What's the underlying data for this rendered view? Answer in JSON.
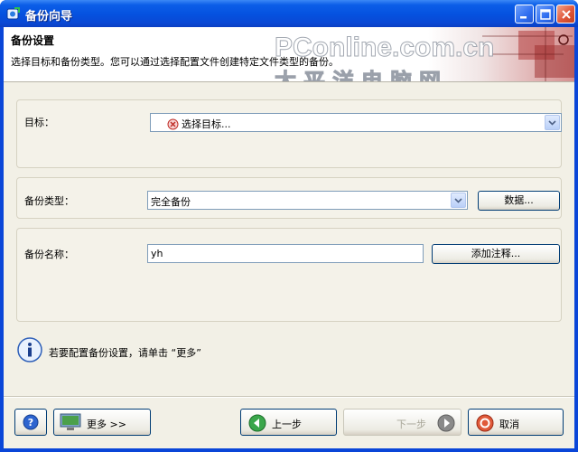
{
  "window": {
    "title": "备份向导"
  },
  "header": {
    "title": "备份设置",
    "description": "选择目标和备份类型。您可以通过选择配置文件创建特定文件类型的备份。",
    "watermark_brand": "PConline.com.cn",
    "watermark_cn": "太平洋电脑网"
  },
  "target": {
    "label": "目标：",
    "value": "选择目标..."
  },
  "backup_type": {
    "label": "备份类型：",
    "value": "完全备份",
    "button": "数据..."
  },
  "backup_name": {
    "label": "备份名称：",
    "value": "yh",
    "button": "添加注释..."
  },
  "info": {
    "text": "若要配置备份设置，请单击 “更多”"
  },
  "footer": {
    "more": "更多 >>",
    "back": "上一步",
    "next": "下一步",
    "cancel": "取消"
  }
}
